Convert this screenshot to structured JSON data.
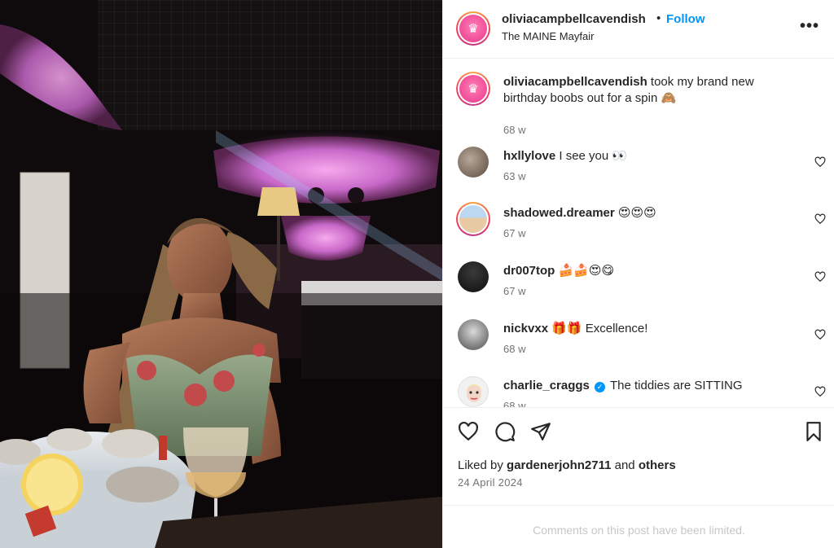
{
  "post": {
    "photo_icon": "photo-restaurant-scene",
    "header": {
      "username": "oliviacampbellcavendish",
      "separator": "•",
      "follow_label": "Follow",
      "location": "The MAINE Mayfair",
      "avatar_icon": "crest-logo-icon",
      "more_icon": "more-options-icon",
      "more_glyph": "•••"
    },
    "caption": {
      "username": "oliviacampbellcavendish",
      "text": "took my brand new birthday boobs out for a spin 🙈",
      "time": "68 w"
    },
    "comments": [
      {
        "username": "hxllylove",
        "text": "I see you 👀",
        "time": "63 w"
      },
      {
        "username": "shadowed.dreamer",
        "text": "😍😍😍",
        "time": "67 w"
      },
      {
        "username": "dr007top",
        "text": "🍰🍰😍😋",
        "time": "67 w"
      },
      {
        "username": "nickvxx",
        "text": "🎁🎁 Excellence!",
        "time": "68 w"
      },
      {
        "username": "charlie_craggs",
        "verified": true,
        "text": "The tiddies are SITTING",
        "time": "68 w"
      }
    ],
    "actions": {
      "like_icon": "heart-icon",
      "comment_icon": "comment-icon",
      "share_icon": "paper-plane-icon",
      "save_icon": "bookmark-icon"
    },
    "likes": {
      "prefix": "Liked by",
      "user": "gardenerjohn2711",
      "middle": "and",
      "suffix": "others"
    },
    "date": "24 April 2024",
    "comments_limited": "Comments on this post have been limited."
  },
  "colors": {
    "accent": "#0095f6",
    "text": "#262626",
    "secondary": "#737373",
    "muted": "#c7c7c7",
    "border": "#efefef"
  }
}
